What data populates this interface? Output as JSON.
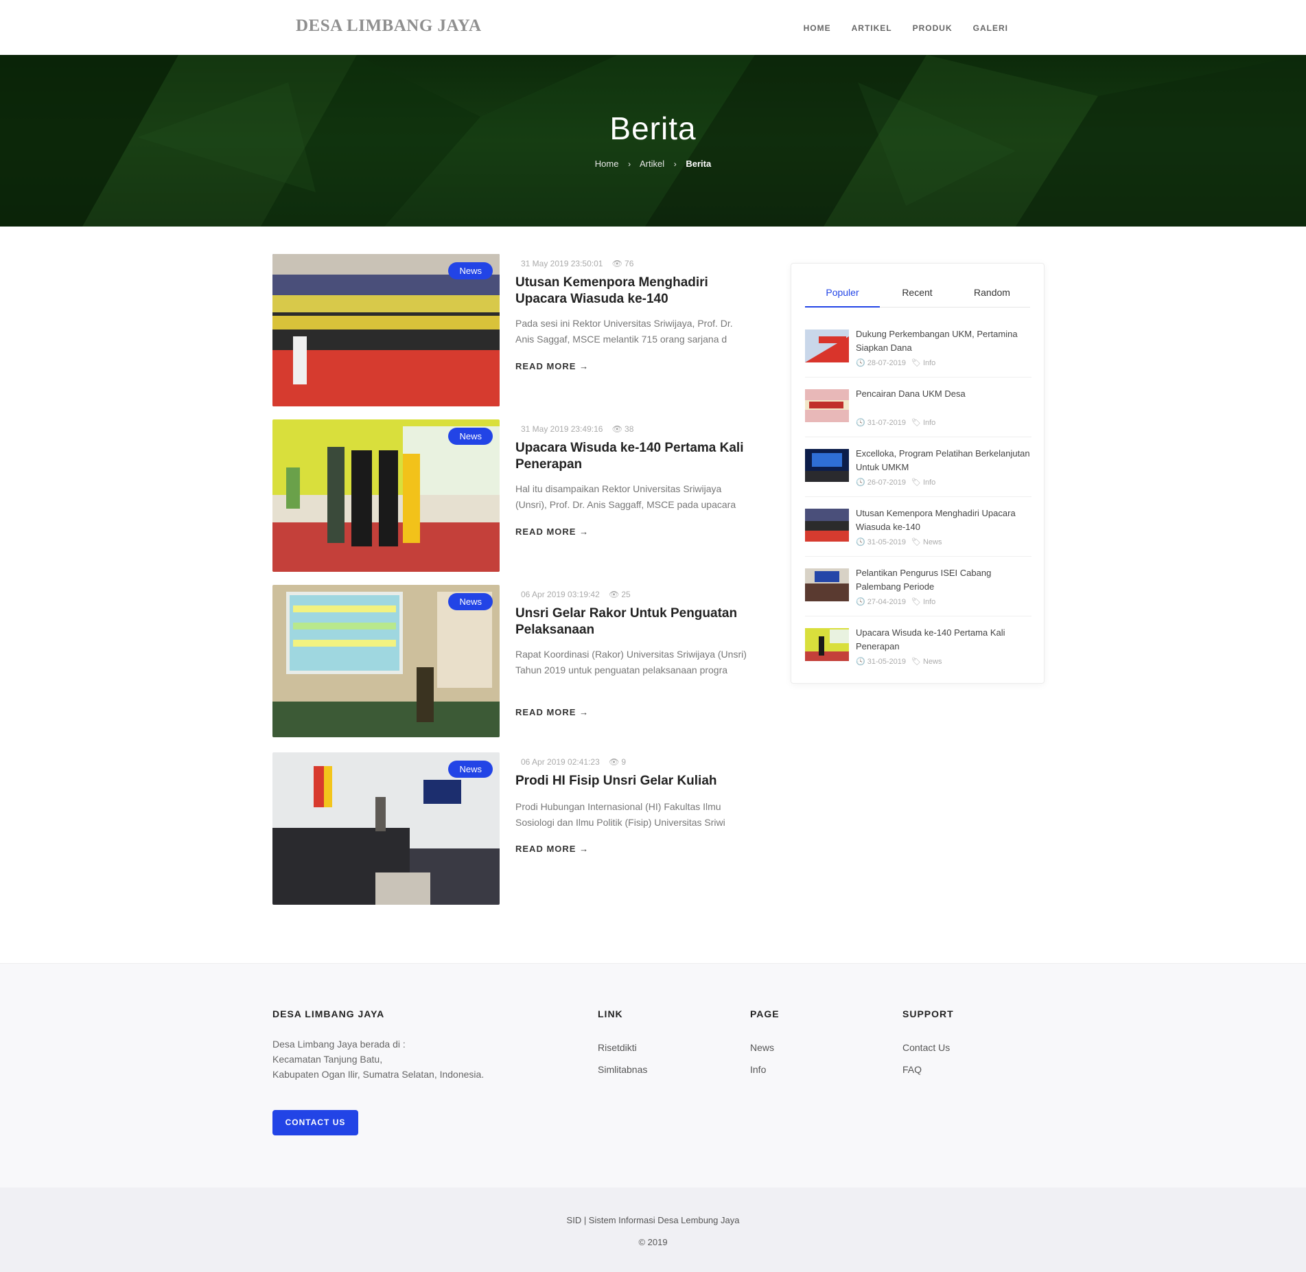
{
  "header": {
    "brand": "DESA LIMBANG JAYA",
    "nav": [
      "HOME",
      "ARTIKEL",
      "PRODUK",
      "GALERI"
    ]
  },
  "hero": {
    "title": "Berita",
    "breadcrumb": [
      "Home",
      "Artikel",
      "Berita"
    ]
  },
  "articles": [
    {
      "badge": "News",
      "date": "31 May 2019 23:50:01",
      "views": "76",
      "title": "Utusan Kemenpora Menghadiri Upacara Wiasuda ke-140",
      "excerpt": "Pada sesi ini Rektor Universitas Sriwijaya, Prof. Dr. Anis Saggaf, MSCE melantik 715 orang sarjana d",
      "read_more": "READ MORE"
    },
    {
      "badge": "News",
      "date": "31 May 2019 23:49:16",
      "views": "38",
      "title": "Upacara Wisuda ke-140 Pertama Kali Penerapan",
      "excerpt": "Hal itu disampaikan Rektor Universitas Sriwijaya (Unsri), Prof. Dr. Anis Saggaff, MSCE pada upacara",
      "read_more": "READ MORE"
    },
    {
      "badge": "News",
      "date": "06 Apr 2019 03:19:42",
      "views": "25",
      "title": "Unsri Gelar Rakor Untuk Penguatan Pelaksanaan",
      "excerpt": "Rapat Koordinasi (Rakor) Universitas Sriwijaya (Unsri) Tahun 2019 untuk penguatan pelaksanaan progra",
      "read_more": "READ MORE"
    },
    {
      "badge": "News",
      "date": "06 Apr 2019 02:41:23",
      "views": "9",
      "title": "Prodi HI Fisip Unsri Gelar Kuliah",
      "excerpt": "Prodi Hubungan Internasional (HI) Fakultas Ilmu Sosiologi dan Ilmu Politik (Fisip) Universitas Sriwi",
      "read_more": "READ MORE"
    }
  ],
  "sidebar": {
    "tabs": [
      "Populer",
      "Recent",
      "Random"
    ],
    "items": [
      {
        "title": "Dukung Perkembangan UKM, Pertamina Siapkan Dana",
        "date": "28-07-2019",
        "tag": "Info"
      },
      {
        "title": "Pencairan Dana UKM Desa",
        "date": "31-07-2019",
        "tag": "Info"
      },
      {
        "title": "Excelloka, Program Pelatihan Berkelanjutan Untuk UMKM",
        "date": "26-07-2019",
        "tag": "Info"
      },
      {
        "title": "Utusan Kemenpora Menghadiri Upacara Wiasuda ke-140",
        "date": "31-05-2019",
        "tag": "News"
      },
      {
        "title": "Pelantikan Pengurus ISEI Cabang Palembang Periode",
        "date": "27-04-2019",
        "tag": "Info"
      },
      {
        "title": "Upacara Wisuda ke-140 Pertama Kali Penerapan",
        "date": "31-05-2019",
        "tag": "News"
      }
    ]
  },
  "footer": {
    "about_title": "DESA LIMBANG JAYA",
    "about_line1": "Desa Limbang Jaya berada di :",
    "about_line2": "Kecamatan Tanjung Batu,",
    "about_line3": "Kabupaten Ogan Ilir, Sumatra Selatan, Indonesia.",
    "contact_button": "CONTACT US",
    "link_title": "LINK",
    "links": [
      "Risetdikti",
      "Simlitabnas"
    ],
    "page_title": "PAGE",
    "pages": [
      "News",
      "Info"
    ],
    "support_title": "SUPPORT",
    "support": [
      "Contact Us",
      "FAQ"
    ],
    "copyright_line1": "SID | Sistem Informasi Desa Lembung Jaya",
    "copyright_line2": "© 2019"
  },
  "colors": {
    "accent": "#2244e6",
    "hero_bg": "#163b12"
  }
}
